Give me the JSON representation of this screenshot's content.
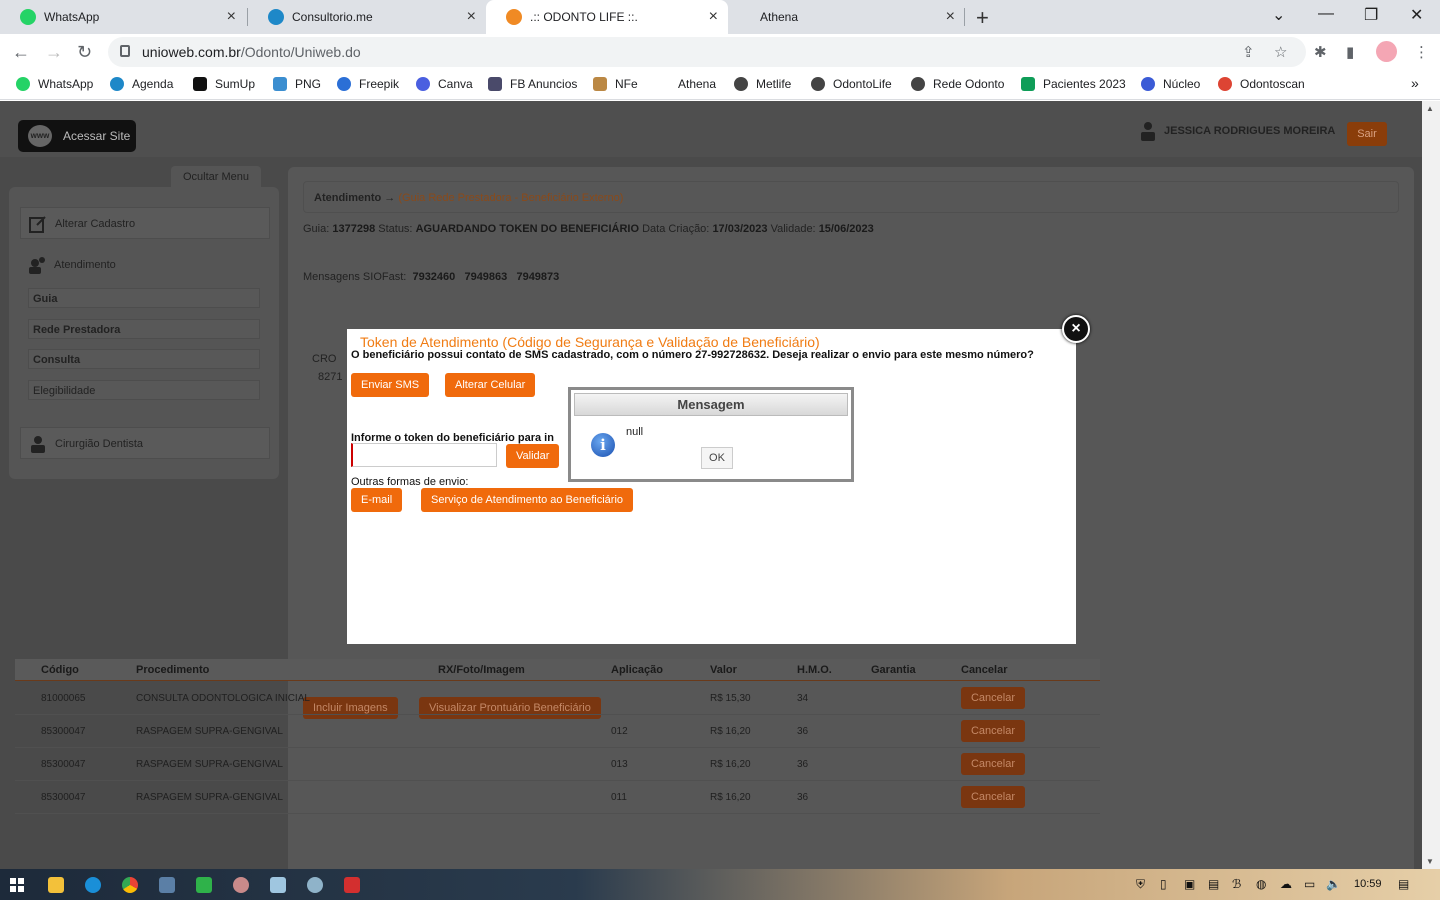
{
  "browser": {
    "tabs": [
      {
        "title": "WhatsApp",
        "color": "#25d366"
      },
      {
        "title": "Consultorio.me",
        "color": "#1e88c8"
      },
      {
        "title": ".:: ODONTO LIFE ::.",
        "color": "#f08a24"
      },
      {
        "title": "Athena",
        "color": "#dee1e6"
      }
    ],
    "url_host": "unioweb.com.br",
    "url_path": "/Odonto/Uniweb.do",
    "bookmarks": [
      "WhatsApp",
      "Agenda",
      "SumUp",
      "PNG",
      "Freepik",
      "Canva",
      "FB Anuncios",
      "NFe",
      "Athena",
      "Metlife",
      "OdontoLife",
      "Rede Odonto",
      "Pacientes 2023",
      "Núcleo",
      "Odontoscan"
    ]
  },
  "header": {
    "site_button": "Acessar Site",
    "site_icon_text": "www",
    "user_name": "JESSICA RODRIGUES MOREIRA",
    "logout": "Sair"
  },
  "sidebar": {
    "hide_menu": "Ocultar Menu",
    "edit_profile": "Alterar Cadastro",
    "service": "Atendimento",
    "sub": [
      "Guia",
      "Rede Prestadora",
      "Consulta",
      "Elegibilidade"
    ],
    "dentist": "Cirurgião Dentista"
  },
  "main": {
    "crumb_label": "Atendimento",
    "crumb_arrow": "→",
    "crumb_sub": "(Guia Rede Prestadora - Beneficiário Externo)",
    "guia_label": "Guia:",
    "guia_value": "1377298",
    "status_label": "Status:",
    "status_value": "AGUARDANDO TOKEN DO BENEFICIÁRIO",
    "created_label": "Data Criação:",
    "created_value": "17/03/2023",
    "valid_label": "Validade:",
    "valid_value": "15/06/2023",
    "sms_label": "Mensagens SIOFast:",
    "sms_values": [
      "7932460",
      "7949863",
      "7949873"
    ],
    "cro_label": "CRO",
    "cro_value": "8271",
    "include_images": "Incluir Imagens",
    "view_record": "Visualizar Prontuário Beneficiário"
  },
  "table": {
    "headers": [
      "Código",
      "Procedimento",
      "RX/Foto/Imagem",
      "Aplicação",
      "Valor",
      "H.M.O.",
      "Garantia",
      "Cancelar"
    ],
    "cancel_label": "Cancelar",
    "rows": [
      {
        "code": "81000065",
        "proc": "CONSULTA ODONTOLOGICA INICIAL",
        "app": "",
        "value": "R$ 15,30",
        "hmo": "34"
      },
      {
        "code": "85300047",
        "proc": "RASPAGEM SUPRA-GENGIVAL",
        "app": "012",
        "value": "R$ 16,20",
        "hmo": "36"
      },
      {
        "code": "85300047",
        "proc": "RASPAGEM SUPRA-GENGIVAL",
        "app": "013",
        "value": "R$ 16,20",
        "hmo": "36"
      },
      {
        "code": "85300047",
        "proc": "RASPAGEM SUPRA-GENGIVAL",
        "app": "011",
        "value": "R$ 16,20",
        "hmo": "36"
      }
    ]
  },
  "modal": {
    "title": "Token de Atendimento (Código de Segurança e Validação de Beneficiário)",
    "sms_question": "O beneficiário possui contato de SMS cadastrado, com o número 27-992728632. Deseja realizar o envio para este mesmo número?",
    "send_sms": "Enviar SMS",
    "change_phone": "Alterar Celular",
    "token_prompt": "Informe o token do beneficiário para in",
    "validate": "Validar",
    "other_methods": "Outras formas de envio:",
    "email": "E-mail",
    "support": "Serviço de Atendimento ao Beneficiário",
    "close": "×"
  },
  "message_box": {
    "title": "Mensagem",
    "text": "null",
    "ok": "OK",
    "icon": "i"
  },
  "taskbar": {
    "time": "10:59"
  }
}
